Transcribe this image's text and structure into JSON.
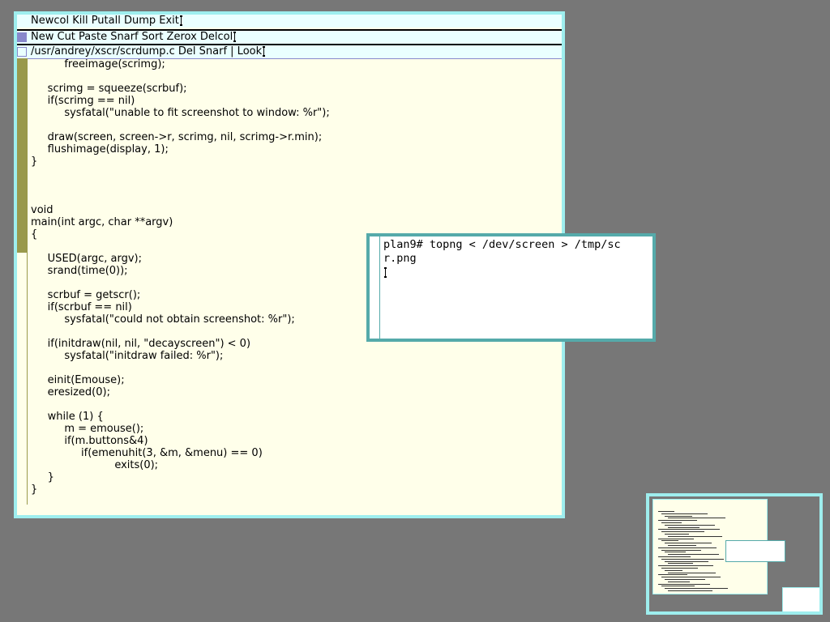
{
  "acme": {
    "column_tag": "Newcol Kill Putall Dump Exit",
    "column_commands": "New Cut Paste Snarf Sort Zerox Delcol",
    "window_tag": "/usr/andrey/xscr/scrdump.c Del Snarf | Look",
    "code_lines": [
      "\t\tfreeimage(scrimg);",
      "",
      "\tscrimg = squeeze(scrbuf);",
      "\tif(scrimg == nil)",
      "\t\tsysfatal(\"unable to fit screenshot to window: %r\");",
      "",
      "\tdraw(screen, screen->r, scrimg, nil, scrimg->r.min);",
      "\tflushimage(display, 1);",
      "}",
      "",
      "",
      "",
      "void",
      "main(int argc, char **argv)",
      "{",
      "",
      "\tUSED(argc, argv);",
      "\tsrand(time(0));",
      "",
      "\tscrbuf = getscr();",
      "\tif(scrbuf == nil)",
      "\t\tsysfatal(\"could not obtain screenshot: %r\");",
      "",
      "\tif(initdraw(nil, nil, \"decayscreen\") < 0)",
      "\t\tsysfatal(\"initdraw failed: %r\");",
      "",
      "\teinit(Emouse);",
      "\teresized(0);",
      "",
      "\twhile (1) {",
      "\t\tm = emouse();",
      "\t\tif(m.buttons&4)",
      "\t\t\tif(emenuhit(3, &m, &menu) == 0)",
      "\t\t\t\t\texits(0);",
      "\t}",
      "}"
    ]
  },
  "terminal": {
    "lines": [
      "plan9# topng < /dev/screen > /tmp/sc",
      "r.png"
    ]
  },
  "colors": {
    "desktop": "#777777",
    "acme_border": "#9eeeee",
    "acme_body": "#ffffea",
    "acme_tag": "#eaffff",
    "scroll_thumb": "#99994c",
    "term_border": "#55aaaa"
  }
}
